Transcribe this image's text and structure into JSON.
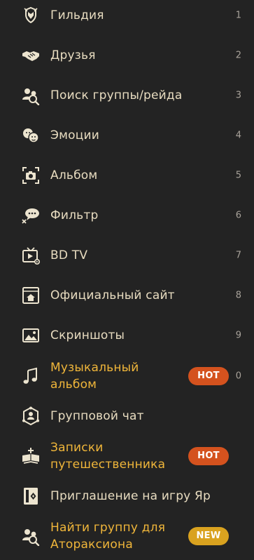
{
  "menu": {
    "items": [
      {
        "label": "Гильдия",
        "key": "1",
        "icon": "guild-crest-icon"
      },
      {
        "label": "Друзья",
        "key": "2",
        "icon": "handshake-icon"
      },
      {
        "label": "Поиск группы/рейда",
        "key": "3",
        "icon": "party-search-icon"
      },
      {
        "label": "Эмоции",
        "key": "4",
        "icon": "emotes-faces-icon"
      },
      {
        "label": "Альбом",
        "key": "5",
        "icon": "camera-album-icon"
      },
      {
        "label": "Фильтр",
        "key": "6",
        "icon": "chat-filter-icon"
      },
      {
        "label": "BD TV",
        "key": "7",
        "icon": "tv-play-icon"
      },
      {
        "label": "Официальный сайт",
        "key": "8",
        "icon": "home-site-icon"
      },
      {
        "label": "Скриншоты",
        "key": "9",
        "icon": "picture-icon"
      },
      {
        "label_line1": "Музыкальный",
        "label_line2": "альбом",
        "key": "0",
        "badge": "HOT",
        "icon": "music-note-icon",
        "highlight": true
      },
      {
        "label": "Групповой чат",
        "icon": "group-chat-icon"
      },
      {
        "label_line1": "Записки",
        "label_line2": "путешественника",
        "badge": "HOT",
        "icon": "traveler-book-icon",
        "highlight": true
      },
      {
        "label": "Приглашение на игру Яр",
        "icon": "invitation-card-icon"
      },
      {
        "label_line1": "Найти группу для",
        "label_line2": "Атораксиона",
        "badge": "NEW",
        "icon": "party-search-icon",
        "highlight": true
      }
    ]
  },
  "colors": {
    "background": "#232323",
    "label": "#e8dcc0",
    "highlight_label": "#f0b63a",
    "hot_badge": "#d4521e",
    "new_badge": "#d9a21f",
    "icon": "#ece4cf"
  }
}
